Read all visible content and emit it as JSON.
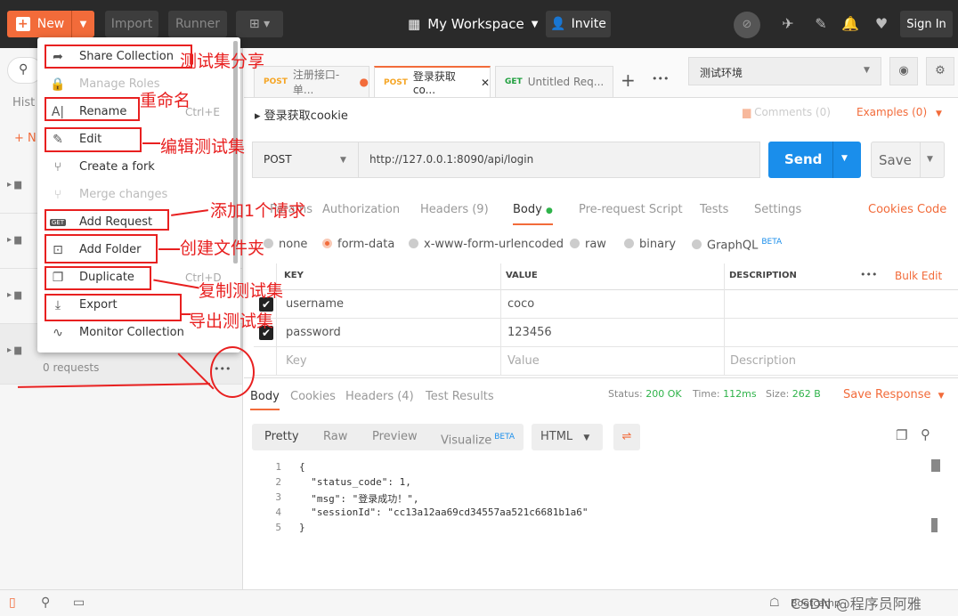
{
  "topbar": {
    "new_label": "New",
    "import_label": "Import",
    "runner_label": "Runner",
    "workspace_label": "My Workspace",
    "invite_label": "Invite",
    "signin_label": "Sign In"
  },
  "sidebar": {
    "history_label": "Hist",
    "new_collection_label": "N",
    "requests_count": "0 requests",
    "more_label": "•••"
  },
  "menu": {
    "items": [
      {
        "label": "Share Collection",
        "icon": "share-icon"
      },
      {
        "label": "Manage Roles",
        "icon": "lock-icon"
      },
      {
        "label": "Rename",
        "icon": "rename-icon",
        "shortcut": "Ctrl+E"
      },
      {
        "label": "Edit",
        "icon": "pencil-icon"
      },
      {
        "label": "Create a fork",
        "icon": "fork-icon"
      },
      {
        "label": "Merge changes",
        "icon": "merge-icon"
      },
      {
        "label": "Add Request",
        "icon": "get-request-icon"
      },
      {
        "label": "Add Folder",
        "icon": "add-folder-icon"
      },
      {
        "label": "Duplicate",
        "icon": "duplicate-icon",
        "shortcut": "Ctrl+D"
      },
      {
        "label": "Export",
        "icon": "export-icon"
      },
      {
        "label": "Monitor Collection",
        "icon": "monitor-icon"
      }
    ]
  },
  "annotations": {
    "share": "测试集分享",
    "rename": "重命名",
    "edit": "编辑测试集",
    "add_request": "添加1个请求",
    "add_folder": "创建文件夹",
    "duplicate": "复制测试集",
    "export": "导出测试集"
  },
  "tabs": [
    {
      "method": "POST",
      "label": "注册接口-单..."
    },
    {
      "method": "POST",
      "label": "登录获取co..."
    },
    {
      "method": "GET",
      "label": "Untitled Req..."
    }
  ],
  "environment": {
    "selected": "测试环境"
  },
  "request": {
    "name": "登录获取cookie",
    "comments": "Comments (0)",
    "examples": "Examples (0)",
    "method": "POST",
    "url": "http://127.0.0.1:8090/api/login",
    "send_label": "Send",
    "save_label": "Save"
  },
  "request_tabs": {
    "params": "Params",
    "authorization": "Authorization",
    "headers": "Headers (9)",
    "body": "Body",
    "prerequest": "Pre-request Script",
    "tests": "Tests",
    "settings": "Settings",
    "cookies": "Cookies",
    "code": "Code"
  },
  "body_types": {
    "none": "none",
    "form_data": "form-data",
    "urlencoded": "x-www-form-urlencoded",
    "raw": "raw",
    "binary": "binary",
    "graphql": "GraphQL",
    "beta": "BETA"
  },
  "form_table": {
    "headers": {
      "key": "KEY",
      "value": "VALUE",
      "description": "DESCRIPTION"
    },
    "bulk_edit": "Bulk Edit",
    "rows": [
      {
        "key": "username",
        "value": "coco"
      },
      {
        "key": "password",
        "value": "123456"
      }
    ],
    "placeholder": {
      "key": "Key",
      "value": "Value",
      "description": "Description"
    }
  },
  "response": {
    "tabs": {
      "body": "Body",
      "cookies": "Cookies",
      "headers": "Headers (4)",
      "tests": "Test Results"
    },
    "status_label": "Status:",
    "status_value": "200 OK",
    "time_label": "Time:",
    "time_value": "112ms",
    "size_label": "Size:",
    "size_value": "262 B",
    "save_response": "Save Response",
    "view": {
      "pretty": "Pretty",
      "raw": "Raw",
      "preview": "Preview",
      "visualize": "Visualize",
      "beta": "BETA",
      "format": "HTML"
    },
    "lines": [
      "{",
      "  \"status_code\": 1,",
      "  \"msg\": \"登录成功！\",",
      "  \"sessionId\": \"cc13a12aa69cd34557aa521c6681b1a6\"",
      "}"
    ],
    "line_numbers": [
      "1",
      "2",
      "3",
      "4",
      "5"
    ]
  },
  "footer": {
    "bootcamp": "Bootcamp",
    "watermark": "CSDN @程序员阿雅"
  },
  "colors": {
    "accent": "#f26b3a",
    "send": "#1a8eeb",
    "annotation": "#e82020"
  }
}
